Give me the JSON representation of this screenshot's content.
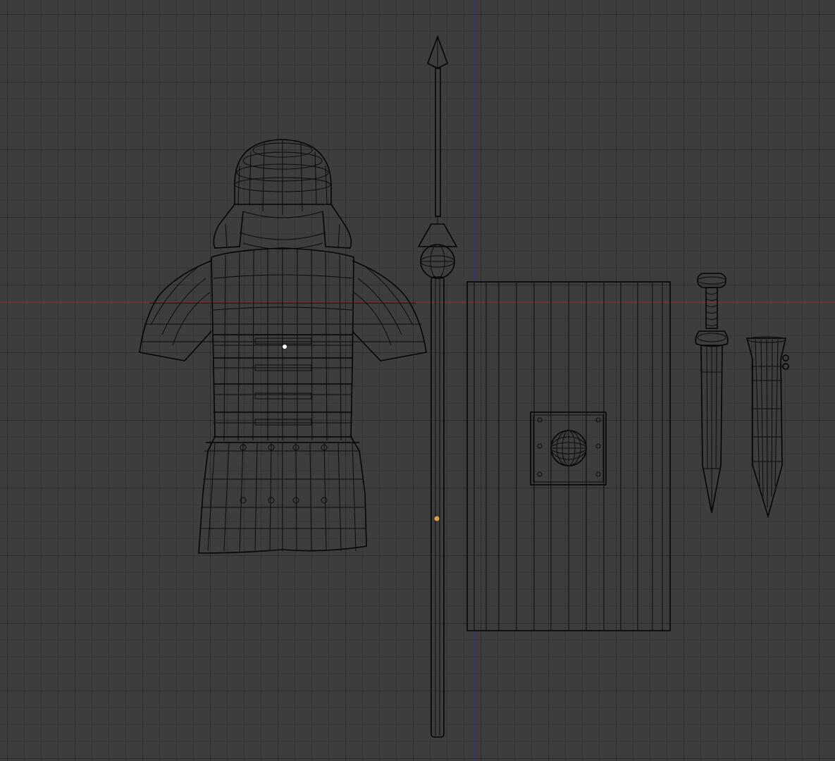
{
  "viewport": {
    "background_color": "#3d3d3d",
    "grid_color": "#2c2c2c",
    "x_axis_color": "#a03030",
    "y_axis_color": "#2e2ea8",
    "wire_color": "#0b0b0b",
    "origin_marker_color": "#e0a040",
    "selected_vertex_color": "#ffffff"
  },
  "objects": [
    {
      "name": "armor-torso-helmet",
      "icon": "mesh-wireframe"
    },
    {
      "name": "spear",
      "icon": "mesh-wireframe"
    },
    {
      "name": "shield-scutum",
      "icon": "mesh-wireframe"
    },
    {
      "name": "sword-gladius",
      "icon": "mesh-wireframe"
    },
    {
      "name": "scabbard",
      "icon": "mesh-wireframe"
    }
  ]
}
